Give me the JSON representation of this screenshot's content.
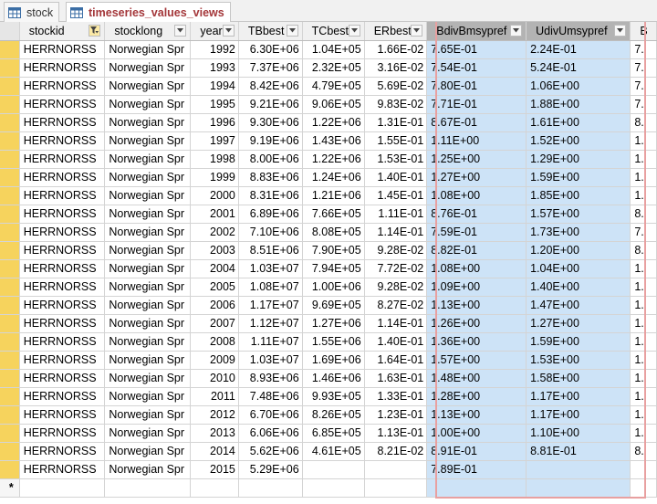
{
  "tabs": [
    {
      "label": "stock",
      "icon": "table-icon",
      "active": false
    },
    {
      "label": "timeseries_values_views",
      "icon": "table-icon",
      "active": true
    }
  ],
  "columns": [
    {
      "label": "stockid",
      "filtered": true
    },
    {
      "label": "stocklong",
      "filtered": false
    },
    {
      "label": "year",
      "filtered": false
    },
    {
      "label": "TBbest",
      "filtered": false
    },
    {
      "label": "TCbest",
      "filtered": false
    },
    {
      "label": "ERbest",
      "filtered": false
    },
    {
      "label": "BdivBmsypref",
      "filtered": false
    },
    {
      "label": "UdivUmsypref",
      "filtered": false
    },
    {
      "label": "B",
      "filtered": false
    }
  ],
  "rows": [
    [
      "HERRNORSS",
      "Norwegian Spr",
      "1992",
      "6.30E+06",
      "1.04E+05",
      "1.66E-02",
      "7.65E-01",
      "2.24E-01",
      "7."
    ],
    [
      "HERRNORSS",
      "Norwegian Spr",
      "1993",
      "7.37E+06",
      "2.32E+05",
      "3.16E-02",
      "7.54E-01",
      "5.24E-01",
      "7."
    ],
    [
      "HERRNORSS",
      "Norwegian Spr",
      "1994",
      "8.42E+06",
      "4.79E+05",
      "5.69E-02",
      "7.80E-01",
      "1.06E+00",
      "7."
    ],
    [
      "HERRNORSS",
      "Norwegian Spr",
      "1995",
      "9.21E+06",
      "9.06E+05",
      "9.83E-02",
      "7.71E-01",
      "1.88E+00",
      "7."
    ],
    [
      "HERRNORSS",
      "Norwegian Spr",
      "1996",
      "9.30E+06",
      "1.22E+06",
      "1.31E-01",
      "8.67E-01",
      "1.61E+00",
      "8."
    ],
    [
      "HERRNORSS",
      "Norwegian Spr",
      "1997",
      "9.19E+06",
      "1.43E+06",
      "1.55E-01",
      "1.11E+00",
      "1.52E+00",
      "1."
    ],
    [
      "HERRNORSS",
      "Norwegian Spr",
      "1998",
      "8.00E+06",
      "1.22E+06",
      "1.53E-01",
      "1.25E+00",
      "1.29E+00",
      "1."
    ],
    [
      "HERRNORSS",
      "Norwegian Spr",
      "1999",
      "8.83E+06",
      "1.24E+06",
      "1.40E-01",
      "1.27E+00",
      "1.59E+00",
      "1."
    ],
    [
      "HERRNORSS",
      "Norwegian Spr",
      "2000",
      "8.31E+06",
      "1.21E+06",
      "1.45E-01",
      "1.08E+00",
      "1.85E+00",
      "1."
    ],
    [
      "HERRNORSS",
      "Norwegian Spr",
      "2001",
      "6.89E+06",
      "7.66E+05",
      "1.11E-01",
      "8.76E-01",
      "1.57E+00",
      "8."
    ],
    [
      "HERRNORSS",
      "Norwegian Spr",
      "2002",
      "7.10E+06",
      "8.08E+05",
      "1.14E-01",
      "7.59E-01",
      "1.73E+00",
      "7."
    ],
    [
      "HERRNORSS",
      "Norwegian Spr",
      "2003",
      "8.51E+06",
      "7.90E+05",
      "9.28E-02",
      "8.82E-01",
      "1.20E+00",
      "8."
    ],
    [
      "HERRNORSS",
      "Norwegian Spr",
      "2004",
      "1.03E+07",
      "7.94E+05",
      "7.72E-02",
      "1.08E+00",
      "1.04E+00",
      "1."
    ],
    [
      "HERRNORSS",
      "Norwegian Spr",
      "2005",
      "1.08E+07",
      "1.00E+06",
      "9.28E-02",
      "1.09E+00",
      "1.40E+00",
      "1."
    ],
    [
      "HERRNORSS",
      "Norwegian Spr",
      "2006",
      "1.17E+07",
      "9.69E+05",
      "8.27E-02",
      "1.13E+00",
      "1.47E+00",
      "1."
    ],
    [
      "HERRNORSS",
      "Norwegian Spr",
      "2007",
      "1.12E+07",
      "1.27E+06",
      "1.14E-01",
      "1.26E+00",
      "1.27E+00",
      "1."
    ],
    [
      "HERRNORSS",
      "Norwegian Spr",
      "2008",
      "1.11E+07",
      "1.55E+06",
      "1.40E-01",
      "1.36E+00",
      "1.59E+00",
      "1."
    ],
    [
      "HERRNORSS",
      "Norwegian Spr",
      "2009",
      "1.03E+07",
      "1.69E+06",
      "1.64E-01",
      "1.57E+00",
      "1.53E+00",
      "1."
    ],
    [
      "HERRNORSS",
      "Norwegian Spr",
      "2010",
      "8.93E+06",
      "1.46E+06",
      "1.63E-01",
      "1.48E+00",
      "1.58E+00",
      "1."
    ],
    [
      "HERRNORSS",
      "Norwegian Spr",
      "2011",
      "7.48E+06",
      "9.93E+05",
      "1.33E-01",
      "1.28E+00",
      "1.17E+00",
      "1."
    ],
    [
      "HERRNORSS",
      "Norwegian Spr",
      "2012",
      "6.70E+06",
      "8.26E+05",
      "1.23E-01",
      "1.13E+00",
      "1.17E+00",
      "1."
    ],
    [
      "HERRNORSS",
      "Norwegian Spr",
      "2013",
      "6.06E+06",
      "6.85E+05",
      "1.13E-01",
      "1.00E+00",
      "1.10E+00",
      "1."
    ],
    [
      "HERRNORSS",
      "Norwegian Spr",
      "2014",
      "5.62E+06",
      "4.61E+05",
      "8.21E-02",
      "8.91E-01",
      "8.81E-01",
      "8."
    ],
    [
      "HERRNORSS",
      "Norwegian Spr",
      "2015",
      "5.29E+06",
      "",
      "",
      "7.89E-01",
      "",
      ""
    ]
  ],
  "new_row_marker": "*",
  "colors": {
    "record_selector": "#f6d35d",
    "selected_cells": "#cde3f7",
    "selected_header": "#b3b3b3",
    "active_tab_text": "#a4373a",
    "selection_outline": "#e8a0a0"
  }
}
